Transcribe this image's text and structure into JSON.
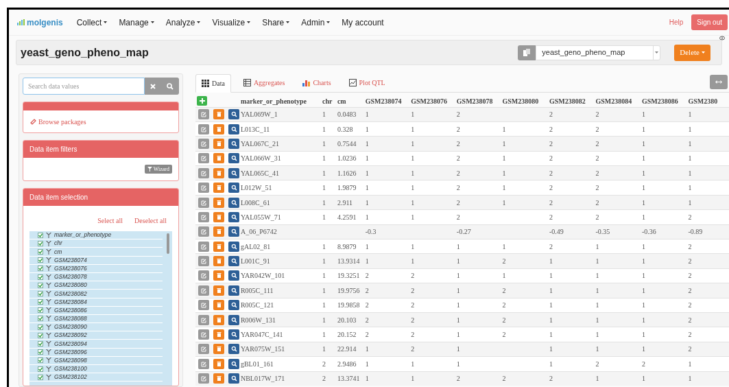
{
  "navbar": {
    "logo": "molgenis",
    "menus": [
      {
        "label": "Collect",
        "dropdown": true
      },
      {
        "label": "Manage",
        "dropdown": true
      },
      {
        "label": "Analyze",
        "dropdown": true
      },
      {
        "label": "Visualize",
        "dropdown": true
      },
      {
        "label": "Share",
        "dropdown": true
      },
      {
        "label": "Admin",
        "dropdown": true
      },
      {
        "label": "My account",
        "dropdown": false
      }
    ],
    "help": "Help",
    "sign_out": "Sign out"
  },
  "header": {
    "title": "yeast_geno_pheno_map",
    "dataset_select": "yeast_geno_pheno_map",
    "delete_button": "Delete"
  },
  "sidebar": {
    "search": {
      "placeholder": "Search data values"
    },
    "browse_packages": "Browse packages",
    "filters": {
      "title": "Data item filters",
      "wizard": "Wizard"
    },
    "selection": {
      "title": "Data item selection",
      "select_all": "Select all",
      "deselect_all": "Deselect all",
      "items": [
        {
          "label": "marker_or_phenotype",
          "checked": true
        },
        {
          "label": "chr",
          "checked": true
        },
        {
          "label": "cm",
          "checked": true
        },
        {
          "label": "GSM238074",
          "checked": true
        },
        {
          "label": "GSM238076",
          "checked": true
        },
        {
          "label": "GSM238078",
          "checked": true
        },
        {
          "label": "GSM238080",
          "checked": true
        },
        {
          "label": "GSM238082",
          "checked": true
        },
        {
          "label": "GSM238084",
          "checked": true
        },
        {
          "label": "GSM238086",
          "checked": true
        },
        {
          "label": "GSM238088",
          "checked": true
        },
        {
          "label": "GSM238090",
          "checked": true
        },
        {
          "label": "GSM238092",
          "checked": true
        },
        {
          "label": "GSM238094",
          "checked": true
        },
        {
          "label": "GSM238096",
          "checked": true
        },
        {
          "label": "GSM238098",
          "checked": true
        },
        {
          "label": "GSM238100",
          "checked": true
        },
        {
          "label": "GSM238102",
          "checked": true
        }
      ]
    }
  },
  "tabs": [
    {
      "label": "Data",
      "selected": true
    },
    {
      "label": "Aggregates",
      "selected": false
    },
    {
      "label": "Charts",
      "selected": false
    },
    {
      "label": "Plot QTL",
      "selected": false
    }
  ],
  "table": {
    "columns": [
      "marker_or_phenotype",
      "chr",
      "cm",
      "GSM238074",
      "GSM238076",
      "GSM238078",
      "GSM238080",
      "GSM238082",
      "GSM238084",
      "GSM238086",
      "GSM2380"
    ],
    "rows": [
      [
        "YAL069W_1",
        "1",
        "0.0483",
        "1",
        "1",
        "2",
        "",
        "2",
        "2",
        "1",
        "1"
      ],
      [
        "L013C_11",
        "1",
        "0.328",
        "1",
        "1",
        "2",
        "1",
        "2",
        "2",
        "1",
        "1"
      ],
      [
        "YAL067C_21",
        "1",
        "0.7544",
        "1",
        "1",
        "2",
        "1",
        "2",
        "2",
        "1",
        "1"
      ],
      [
        "YAL066W_31",
        "1",
        "1.0236",
        "1",
        "1",
        "2",
        "1",
        "2",
        "2",
        "1",
        "1"
      ],
      [
        "YAL065C_41",
        "1",
        "1.1626",
        "1",
        "1",
        "2",
        "1",
        "2",
        "2",
        "1",
        "1"
      ],
      [
        "L012W_51",
        "1",
        "1.9879",
        "1",
        "1",
        "2",
        "1",
        "2",
        "2",
        "1",
        "1"
      ],
      [
        "L008C_61",
        "1",
        "2.911",
        "1",
        "1",
        "2",
        "1",
        "2",
        "2",
        "1",
        "1"
      ],
      [
        "YAL055W_71",
        "1",
        "4.2591",
        "1",
        "1",
        "2",
        "",
        "2",
        "2",
        "1",
        "2"
      ],
      [
        "A_06_P6742",
        "",
        "",
        "-0.3",
        "",
        "-0.27",
        "",
        "-0.49",
        "-0.35",
        "-0.36",
        "-0.89"
      ],
      [
        "gAL02_81",
        "1",
        "8.9879",
        "1",
        "1",
        "1",
        "1",
        "2",
        "1",
        "1",
        "2"
      ],
      [
        "L001C_91",
        "1",
        "13.9314",
        "1",
        "1",
        "1",
        "2",
        "1",
        "1",
        "1",
        "2"
      ],
      [
        "YAR042W_101",
        "1",
        "19.3251",
        "2",
        "2",
        "1",
        "1",
        "1",
        "1",
        "1",
        "2"
      ],
      [
        "R005C_111",
        "1",
        "19.9756",
        "2",
        "2",
        "1",
        "2",
        "1",
        "1",
        "1",
        "2"
      ],
      [
        "R005C_121",
        "1",
        "19.9858",
        "2",
        "2",
        "1",
        "2",
        "1",
        "1",
        "1",
        "2"
      ],
      [
        "R006W_131",
        "1",
        "20.103",
        "2",
        "2",
        "1",
        "2",
        "1",
        "1",
        "1",
        "2"
      ],
      [
        "YAR047C_141",
        "1",
        "20.152",
        "2",
        "2",
        "1",
        "2",
        "1",
        "1",
        "1",
        "2"
      ],
      [
        "YAR075W_151",
        "1",
        "22.914",
        "1",
        "2",
        "1",
        "",
        "1",
        "1",
        "1",
        "2"
      ],
      [
        "gBL01_161",
        "2",
        "2.9486",
        "1",
        "1",
        "1",
        "",
        "1",
        "2",
        "2",
        "1"
      ],
      [
        "NBL017W_171",
        "2",
        "13.3741",
        "1",
        "1",
        "2",
        "2",
        "2",
        "1",
        "1",
        "1"
      ]
    ]
  }
}
